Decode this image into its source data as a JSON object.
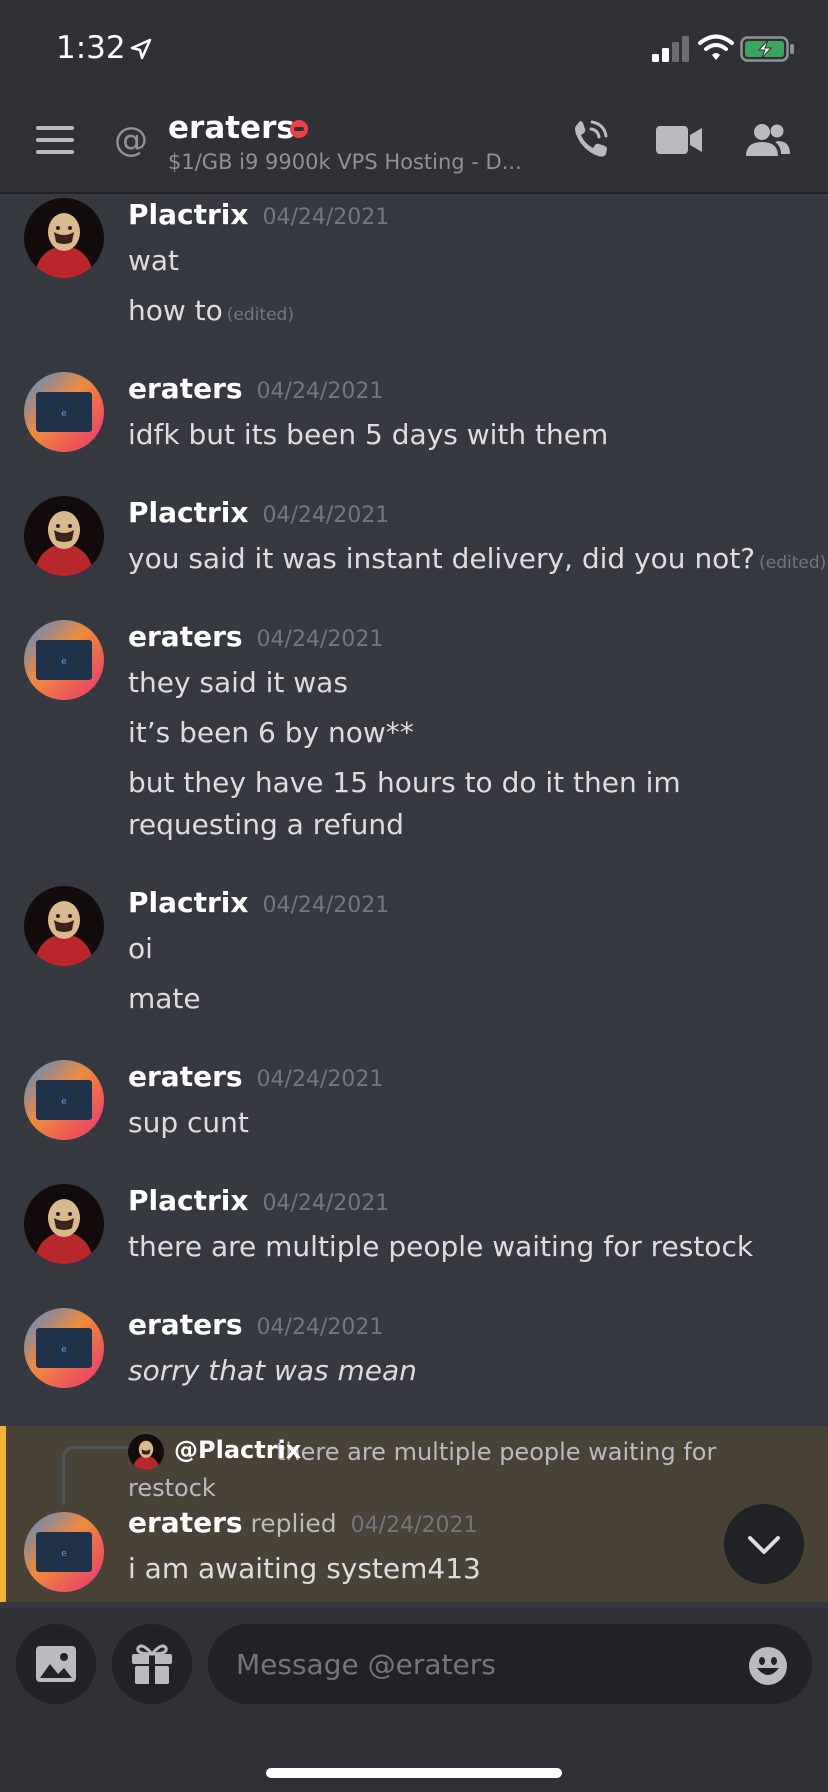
{
  "status_bar": {
    "time": "1:32"
  },
  "header": {
    "title": "eraters",
    "subtitle": "$1/GB i9 9900k VPS Hosting - D...",
    "at_symbol": "@"
  },
  "messages": [
    {
      "author": "Plactrix",
      "timestamp": "04/24/2021",
      "lines": [
        {
          "text": "wat"
        },
        {
          "text": "how to",
          "edited": "(edited)"
        }
      ]
    },
    {
      "author": "eraters",
      "timestamp": "04/24/2021",
      "lines": [
        {
          "text": "idfk but its been 5 days with them"
        }
      ]
    },
    {
      "author": "Plactrix",
      "timestamp": "04/24/2021",
      "lines": [
        {
          "text": "you said it was instant delivery, did you not?",
          "edited": "(edited)"
        }
      ]
    },
    {
      "author": "eraters",
      "timestamp": "04/24/2021",
      "lines": [
        {
          "text": "they said it was"
        },
        {
          "text": "it’s been 6 by now**"
        },
        {
          "text": "but they have 15 hours to do it then im requesting a refund"
        }
      ]
    },
    {
      "author": "Plactrix",
      "timestamp": "04/24/2021",
      "lines": [
        {
          "text": "oi"
        },
        {
          "text": "mate"
        }
      ]
    },
    {
      "author": "eraters",
      "timestamp": "04/24/2021",
      "lines": [
        {
          "text": "sup cunt"
        }
      ]
    },
    {
      "author": "Plactrix",
      "timestamp": "04/24/2021",
      "lines": [
        {
          "text": "there are multiple people waiting for restock"
        }
      ]
    },
    {
      "author": "eraters",
      "timestamp": "04/24/2021",
      "lines": [
        {
          "text": "sorry that was mean"
        }
      ]
    }
  ],
  "reply_message": {
    "reply_mention": "@Plactrix",
    "reply_snippet": "there are multiple people waiting for restock",
    "author": "eraters",
    "replied_label": "replied",
    "timestamp": "04/24/2021",
    "text": "i am awaiting system413"
  },
  "composer": {
    "placeholder": "Message @eraters"
  },
  "colors": {
    "background": "#36393f",
    "header": "#2f3136",
    "highlight": "#494237",
    "accent": "#f0b232",
    "dnd": "#ed4245"
  },
  "icons": [
    "location-arrow-icon",
    "signal-icon",
    "wifi-icon",
    "battery-icon",
    "menu-icon",
    "at-icon",
    "call-icon",
    "video-icon",
    "members-icon",
    "chevron-down-icon",
    "image-icon",
    "gift-icon",
    "emoji-icon"
  ]
}
